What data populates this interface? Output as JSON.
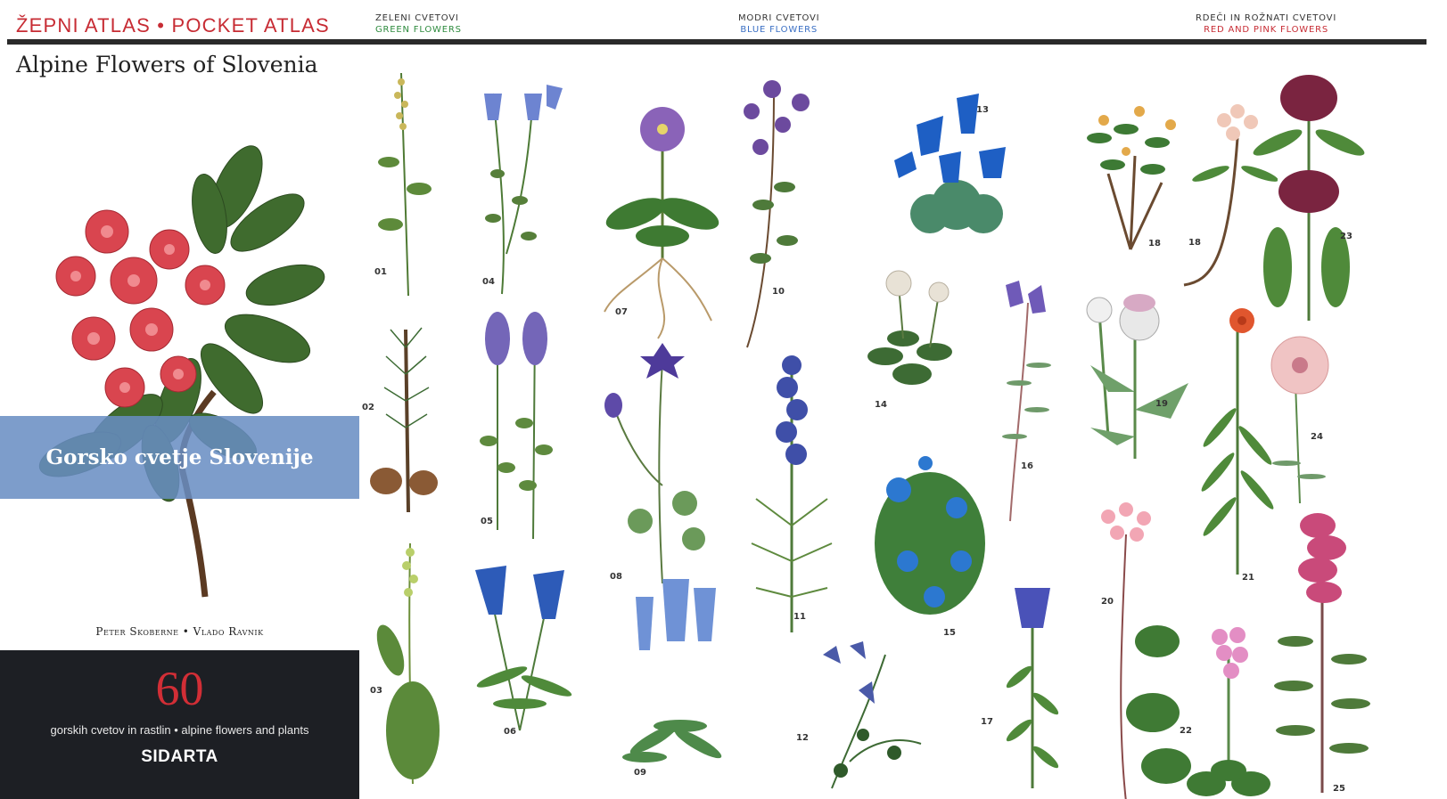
{
  "header": {
    "brand": "ŽEPNI ATLAS • POCKET ATLAS",
    "sections": [
      {
        "sl": "ZELENI CVETOVI",
        "en": "GREEN FLOWERS",
        "color": "#2e8b3e"
      },
      {
        "sl": "MODRI CVETOVI",
        "en": "BLUE FLOWERS",
        "color": "#3a6fc4"
      },
      {
        "sl": "RDEČI IN ROŽNATI CVETOVI",
        "en": "RED AND PINK FLOWERS",
        "color": "#c72c34"
      }
    ]
  },
  "cover": {
    "title": "Alpine Flowers of Slovenia",
    "banner": "Gorsko cvetje Slovenije",
    "authors": "Peter Skoberne • Vlado Ravnik",
    "count": "60",
    "subtitle": "gorskih cvetov in rastlin • alpine flowers and plants",
    "publisher": "SIDARTA"
  },
  "plates": [
    {
      "num": "01",
      "color": "#c9b75a"
    },
    {
      "num": "02",
      "color": "#8a5a35"
    },
    {
      "num": "03",
      "color": "#b9cf6a"
    },
    {
      "num": "04",
      "color": "#6d84d1"
    },
    {
      "num": "05",
      "color": "#7466b8"
    },
    {
      "num": "06",
      "color": "#2d5bb8"
    },
    {
      "num": "07",
      "color": "#8a63b8"
    },
    {
      "num": "08",
      "color": "#4e3a9a"
    },
    {
      "num": "09",
      "color": "#6f92d6"
    },
    {
      "num": "10",
      "color": "#6c4a9e"
    },
    {
      "num": "11",
      "color": "#3f4fa8"
    },
    {
      "num": "12",
      "color": "#4a5aa8"
    },
    {
      "num": "13",
      "color": "#1e5fc4"
    },
    {
      "num": "14",
      "color": "#e8e2d6"
    },
    {
      "num": "15",
      "color": "#2c78d0"
    },
    {
      "num": "16",
      "color": "#6f5ab8"
    },
    {
      "num": "17",
      "color": "#4a52b8"
    },
    {
      "num": "18",
      "color": "#e3a94a"
    },
    {
      "num": "18",
      "color": "#f0c8b8"
    },
    {
      "num": "19",
      "color": "#d7a9c4"
    },
    {
      "num": "20",
      "color": "#f2a6b4"
    },
    {
      "num": "21",
      "color": "#e0562e"
    },
    {
      "num": "22",
      "color": "#e38ec4"
    },
    {
      "num": "23",
      "color": "#7a2440"
    },
    {
      "num": "24",
      "color": "#f0c4c4"
    },
    {
      "num": "25",
      "color": "#c94a7a"
    }
  ]
}
